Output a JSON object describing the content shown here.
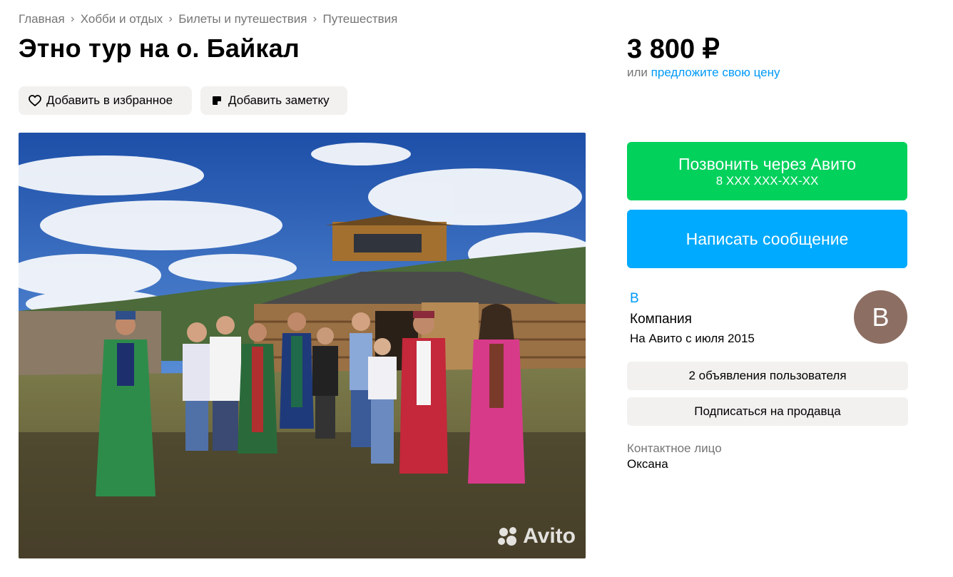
{
  "breadcrumb": [
    "Главная",
    "Хобби и отдых",
    "Билеты и путешествия",
    "Путешествия"
  ],
  "title": "Этно тур на о. Байкал",
  "actions": {
    "favorite": "Добавить в избранное",
    "note": "Добавить заметку"
  },
  "photo": {
    "watermark": "Avito"
  },
  "price": {
    "value": "3 800 ₽",
    "or": "или",
    "offer_link": "предложите свою цену"
  },
  "contact": {
    "call_label": "Позвонить через Авито",
    "phone": "8 XXX XXX-XX-XX",
    "message_label": "Написать сообщение"
  },
  "seller": {
    "name": "В",
    "type": "Компания",
    "since": "На Авито с июля 2015",
    "avatar_letter": "B",
    "ads_label": "2 объявления пользователя",
    "subscribe_label": "Подписаться на продавца"
  },
  "contact_person": {
    "label": "Контактное лицо",
    "name": "Оксана"
  },
  "colors": {
    "green": "#02d15c",
    "blue": "#00aaff",
    "link": "#0099f7",
    "avatar": "#8d6e63"
  }
}
